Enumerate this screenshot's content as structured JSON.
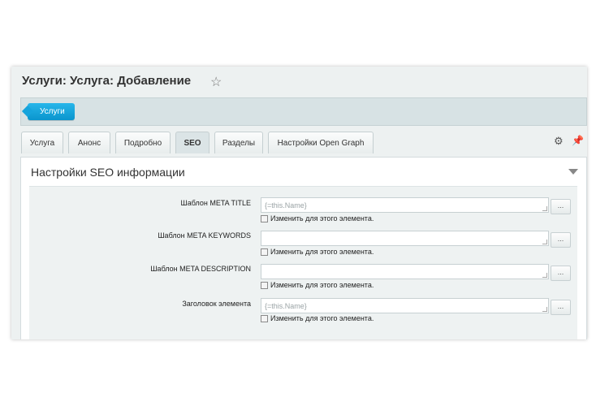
{
  "page": {
    "title": "Услуги: Услуга: Добавление",
    "star_icon": "star-icon"
  },
  "navbar": {
    "button_label": "Услуги"
  },
  "tabs": [
    {
      "label": "Услуга"
    },
    {
      "label": "Анонс"
    },
    {
      "label": "Подробно"
    },
    {
      "label": "SEO"
    },
    {
      "label": "Разделы"
    },
    {
      "label": "Настройки Open Graph"
    }
  ],
  "active_tab": "SEO",
  "toolbar": {
    "gear_icon": "gear-icon",
    "pin_icon": "pin-icon"
  },
  "panel": {
    "title": "Настройки SEO информации"
  },
  "fields": [
    {
      "label": "Шаблон META TITLE",
      "value": "{=this.Name}",
      "checkbox_label": "Изменить для этого элемента.",
      "button_label": "..."
    },
    {
      "label": "Шаблон META KEYWORDS",
      "value": "",
      "checkbox_label": "Изменить для этого элемента.",
      "button_label": "..."
    },
    {
      "label": "Шаблон META DESCRIPTION",
      "value": "",
      "checkbox_label": "Изменить для этого элемента.",
      "button_label": "..."
    },
    {
      "label": "Заголовок элемента",
      "value": "{=this.Name}",
      "checkbox_label": "Изменить для этого элемента.",
      "button_label": "..."
    }
  ],
  "colors": {
    "accent": "#0a95cd",
    "navbar_bg": "#d7e2e4",
    "panel_bg": "#ffffff",
    "frame_bg": "#edf1f1"
  }
}
